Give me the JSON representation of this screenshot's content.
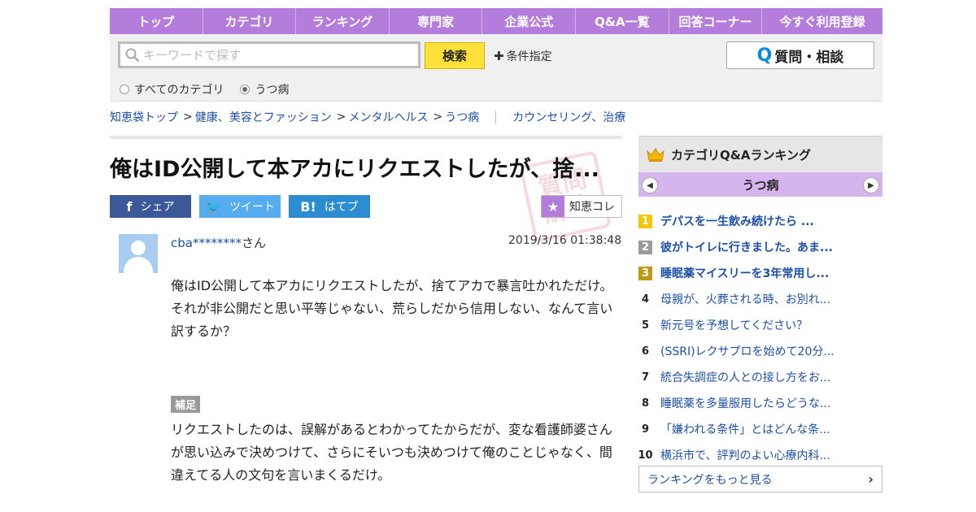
{
  "nav": [
    "トップ",
    "カテゴリ",
    "ランキング",
    "専門家",
    "企業公式",
    "Q&A一覧",
    "回答コーナー",
    "今すぐ利用登録"
  ],
  "search": {
    "placeholder": "キーワードで探す",
    "button": "検索",
    "condition": "条件指定",
    "ask_button": "質問・相談",
    "ask_q": "Q"
  },
  "radios": [
    {
      "label": "すべてのカテゴリ",
      "checked": false
    },
    {
      "label": "うつ病",
      "checked": true
    }
  ],
  "breadcrumb": {
    "items": [
      "知恵袋トップ",
      "健康、美容とファッション",
      "メンタルヘルス",
      "うつ病"
    ],
    "sep": ">",
    "extra": "カウンセリング、治療"
  },
  "question": {
    "title": "俺はID公開して本アカにリクエストしたが、捨...",
    "stamp": "質問\n解決",
    "share": {
      "facebook": "シェア",
      "twitter": "ツイート",
      "hatena": "はてブ",
      "chie": "知恵コレ"
    },
    "user": "cba********",
    "user_suffix": "さん",
    "date": "2019/3/16  01:38:48",
    "body": [
      "俺はID公開して本アカにリクエストしたが、捨てアカで暴言吐かれただけ。",
      "それが非公開だと思い平等じゃない、荒らしだから信用しない、なんて言い訳するか？"
    ],
    "hosoku_label": "補足",
    "hosoku": "リクエストしたのは、誤解があるとわかってたからだが、変な看護師婆さんが思い込みで決めつけて、さらにそいつも決めつけて俺のことじゃなく、間違えてる人の文句を言いまくるだけ。"
  },
  "ranking": {
    "title": "カテゴリQ&Aランキング",
    "tab": "うつ病",
    "items": [
      {
        "num": "1",
        "text": "デパスを一生飲み続けたら ..."
      },
      {
        "num": "2",
        "text": "彼がトイレに行きました。あま..."
      },
      {
        "num": "3",
        "text": "睡眠薬マイスリーを3年常用し..."
      },
      {
        "num": "4",
        "text": "母親が、火葬される時、お別れ..."
      },
      {
        "num": "5",
        "text": "新元号を予想してください？"
      },
      {
        "num": "6",
        "text": "(SSRI)レクサプロを始めて20分..."
      },
      {
        "num": "7",
        "text": "統合失調症の人との接し方をお..."
      },
      {
        "num": "8",
        "text": "睡眠薬を多量服用したらどうな..."
      },
      {
        "num": "9",
        "text": "「嫌われる条件」とはどんな条..."
      },
      {
        "num": "10",
        "text": "横浜市で、評判のよい心療内科..."
      }
    ],
    "more": "ランキングをもっと見る"
  },
  "colors": {
    "nav": "#b57ddb",
    "search_button": "#ffe13a",
    "link": "#1c4fa8",
    "rank_tab": "#d6b5ef"
  }
}
